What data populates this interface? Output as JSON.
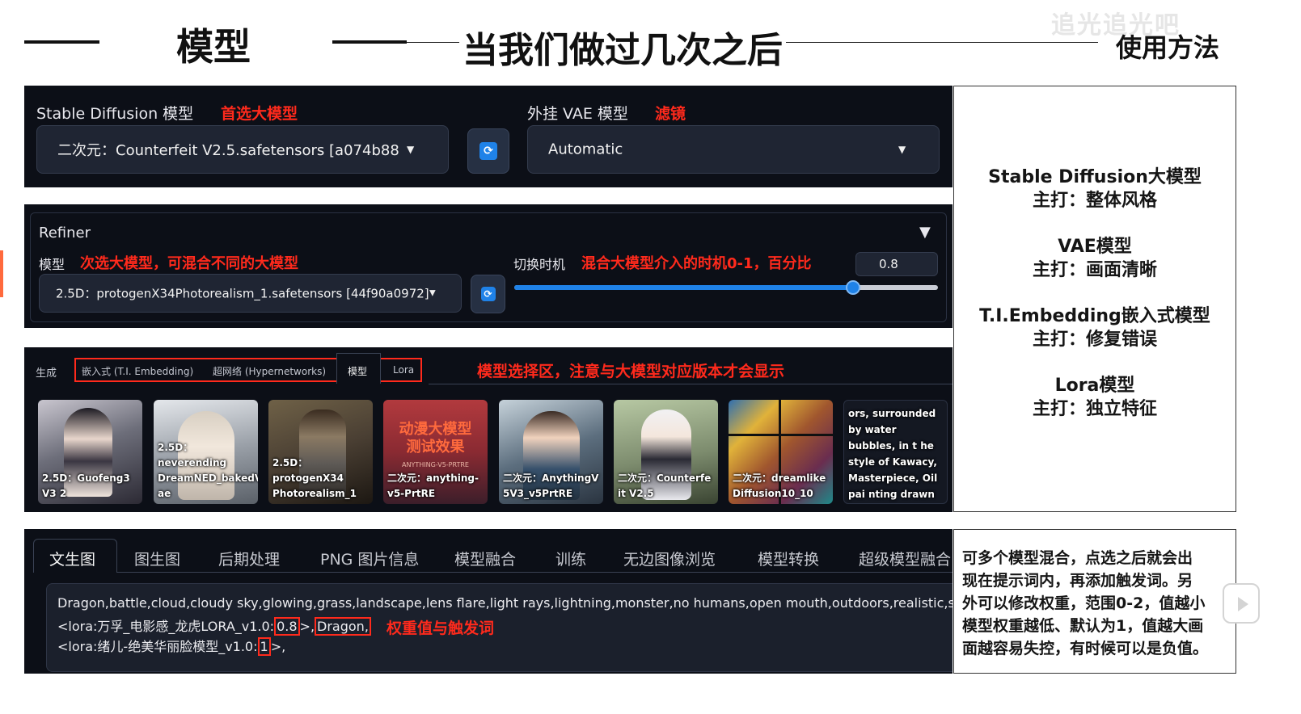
{
  "header": {
    "title_left": "模型",
    "title_center": "当我们做过几次之后",
    "title_right": "使用方法",
    "watermark": "追光追光吧"
  },
  "sd_model": {
    "label": "Stable Diffusion 模型",
    "note": "首选大模型",
    "value": "二次元：Counterfeit V2.5.safetensors [a074b88",
    "caret": "▼"
  },
  "vae": {
    "label": "外挂 VAE 模型",
    "note": "滤镜",
    "value": "Automatic",
    "caret": "▼"
  },
  "refiner": {
    "title": "Refiner",
    "toggle": "▼",
    "model_label": "模型",
    "model_note": "次选大模型，可混合不同的大模型",
    "model_value": "2.5D：protogenX34Photorealism_1.safetensors [44f90a0972]",
    "caret": "▼",
    "switch_label": "切换时机",
    "switch_note": "混合大模型介入的时机0-1，百分比",
    "switch_value": "0.8",
    "switch_fraction": 0.8
  },
  "extra_networks": {
    "tabs": [
      "生成",
      "嵌入式 (T.I. Embedding)",
      "超网络 (Hypernetworks)",
      "模型",
      "Lora"
    ],
    "note": "模型选择区，注意与大模型对应版本才会显示",
    "cards": [
      {
        "caption": "2.5D：Guofeng3 V3 2",
        "bg": "#6d6e7a"
      },
      {
        "caption": "2.5D：neverending DreamNED_bakedV ae",
        "bg": "#9aa0a8"
      },
      {
        "caption": "2.5D：protogenX34 Photorealism_1",
        "bg": "#4a3f33"
      },
      {
        "caption": "二次元：anything- v5-PrtRE",
        "overlay": "动漫大模型 测试效果",
        "sub": "ANYTHING-V5-PRTRE",
        "bg": "#8a2a32"
      },
      {
        "caption": "二次元：AnythingV 5V3_v5PrtRE",
        "bg": "#5c6e7e"
      },
      {
        "caption": "二次元：Counterfe it V2.5",
        "bg": "#7d8c6e"
      },
      {
        "caption": "二次元：dreamlike Diffusion10_10",
        "bg": "#a0562e"
      },
      {
        "caption": "ors, surrounded by water bubbles, in t he style of Kawacy, Masterpiece, Oil pai nting drawn in ani me",
        "bg": "#141822"
      }
    ]
  },
  "main_tabs": {
    "items": [
      "文生图",
      "图生图",
      "后期处理",
      "PNG 图片信息",
      "模型融合",
      "训练",
      "无边图像浏览",
      "模型转换",
      "超级模型融合"
    ],
    "active": "文生图"
  },
  "prompt": {
    "line1": "Dragon,battle,cloud,cloudy sky,glowing,grass,landscape,lens flare,light rays,lightning,monster,no humans,open mouth,outdoors,realistic,sharp teeth",
    "line2_pre": "<lora:万孚_电影感_龙虎LORA_v1.0:",
    "line2_weight": "0.8",
    "line2_mid": ">,",
    "line2_trigger": "Dragon,",
    "line3_pre": "<lora:绪儿-绝美华丽脸模型_v1.0:",
    "line3_weight": "1",
    "line3_end": ">,",
    "note": "权重值与触发词"
  },
  "usage": {
    "items": [
      {
        "name": "Stable Diffusion大模型",
        "desc": "主打：整体风格"
      },
      {
        "name": "VAE模型",
        "desc": "主打：画面清晰"
      },
      {
        "name": "T.I.Embedding嵌入式模型",
        "desc": "主打：修复错误"
      },
      {
        "name": "Lora模型",
        "desc": "主打：独立特征"
      }
    ]
  },
  "lora_note": {
    "lines": [
      "可多个模型混合，点选之后就会出",
      "现在提示词内，再添加触发词。另",
      "外可以修改权重，范围0-2，值越小",
      "模型权重越低、默认为1，值越大画",
      "面越容易失控，有时候可以是负值。"
    ]
  },
  "colors": {
    "panel_bg": "#0c0f17",
    "accent_red": "#ff2a1c",
    "slider_blue": "#1f82e8"
  }
}
